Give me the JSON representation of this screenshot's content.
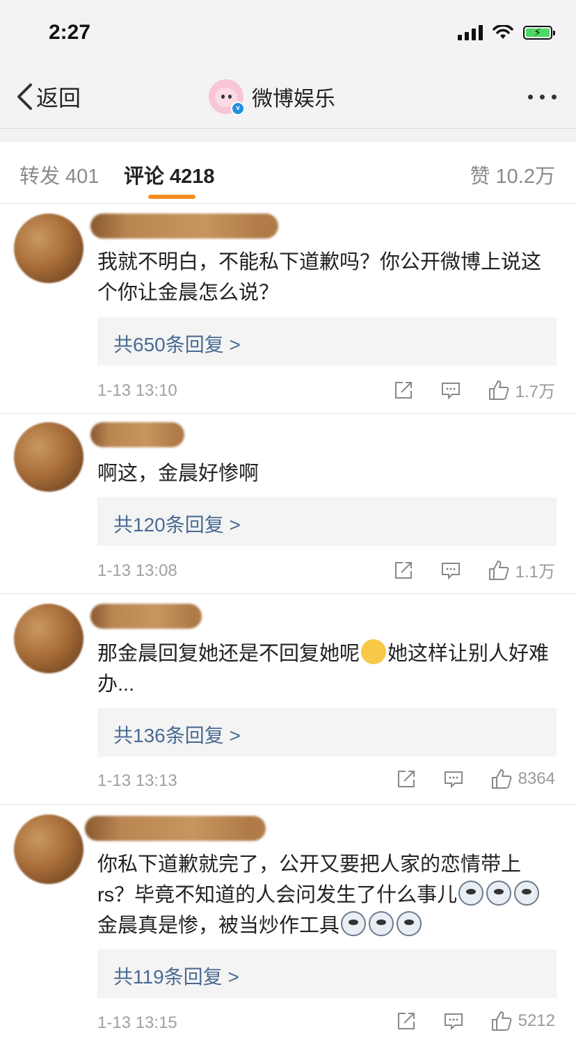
{
  "status_bar": {
    "time": "2:27"
  },
  "nav": {
    "back_label": "返回",
    "title": "微博娱乐",
    "verified_mark": "v"
  },
  "tabs": {
    "repost_label": "转发",
    "repost_count": "401",
    "comment_label": "评论",
    "comment_count": "4218",
    "like_label": "赞",
    "like_count": "10.2万",
    "accent_color": "#f28c1e"
  },
  "comments": [
    {
      "text": "我就不明白，不能私下道歉吗？你公开微博上说这个你让金晨怎么说？",
      "replies": "共650条回复 >",
      "time": "1-13 13:10",
      "likes": "1.7万"
    },
    {
      "text": "啊这，金晨好惨啊",
      "replies": "共120条回复 >",
      "time": "1-13 13:08",
      "likes": "1.1万"
    },
    {
      "text_a": "那金晨回复她还是不回复她呢",
      "text_b": "她这样让别人好难办...",
      "replies": "共136条回复 >",
      "time": "1-13 13:13",
      "likes": "8364"
    },
    {
      "text_a": "你私下道歉就完了，公开又要把人家的恋情带上rs？毕竟不知道的人会问发生了什么事儿",
      "text_b": "金晨真是惨，被当炒作工具",
      "replies": "共119条回复 >",
      "time": "1-13 13:15",
      "likes": "5212"
    }
  ],
  "icons": {
    "share": "share-icon",
    "comment": "comment-icon",
    "like": "thumbs-up-icon"
  },
  "colors": {
    "link": "#4a6a92",
    "meta": "#a0a0a0",
    "battery": "#4cd964"
  }
}
